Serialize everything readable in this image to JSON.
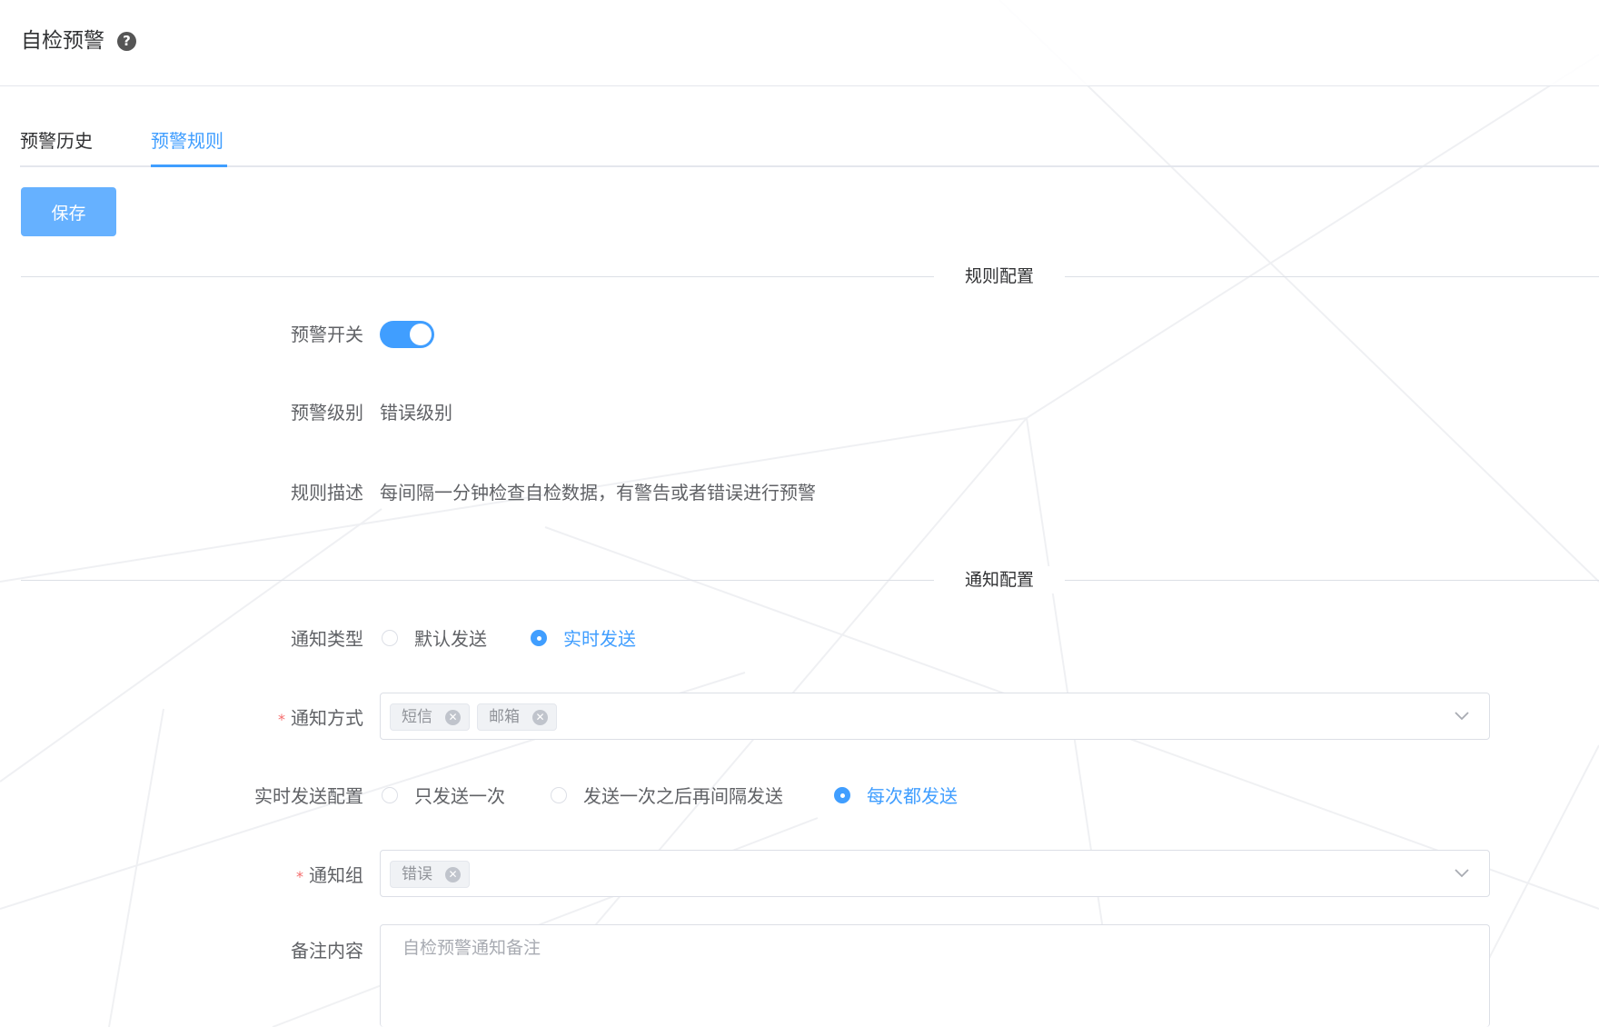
{
  "header": {
    "title": "自检预警",
    "help_icon": "question-circle-icon"
  },
  "tabs": [
    {
      "label": "预警历史",
      "active": false
    },
    {
      "label": "预警规则",
      "active": true
    }
  ],
  "toolbar": {
    "save_label": "保存"
  },
  "sections": {
    "rule": "规则配置",
    "notify": "通知配置"
  },
  "form": {
    "switch": {
      "label": "预警开关",
      "on": true
    },
    "level": {
      "label": "预警级别",
      "value": "错误级别"
    },
    "desc": {
      "label": "规则描述",
      "value": "每间隔一分钟检查自检数据，有警告或者错误进行预警"
    },
    "notify_type": {
      "label": "通知类型",
      "options": [
        "默认发送",
        "实时发送"
      ],
      "selected": "实时发送"
    },
    "notify_method": {
      "label": "通知方式",
      "required": true,
      "tags": [
        "短信",
        "邮箱"
      ]
    },
    "realtime": {
      "label": "实时发送配置",
      "options": [
        "只发送一次",
        "发送一次之后再间隔发送",
        "每次都发送"
      ],
      "selected": "每次都发送"
    },
    "group": {
      "label": "通知组",
      "required": true,
      "tags": [
        "错误"
      ]
    },
    "remark": {
      "label": "备注内容",
      "placeholder": "自检预警通知备注"
    }
  },
  "colors": {
    "primary": "#409eff",
    "primary_light": "#66b1ff",
    "required": "#f56c6c"
  }
}
